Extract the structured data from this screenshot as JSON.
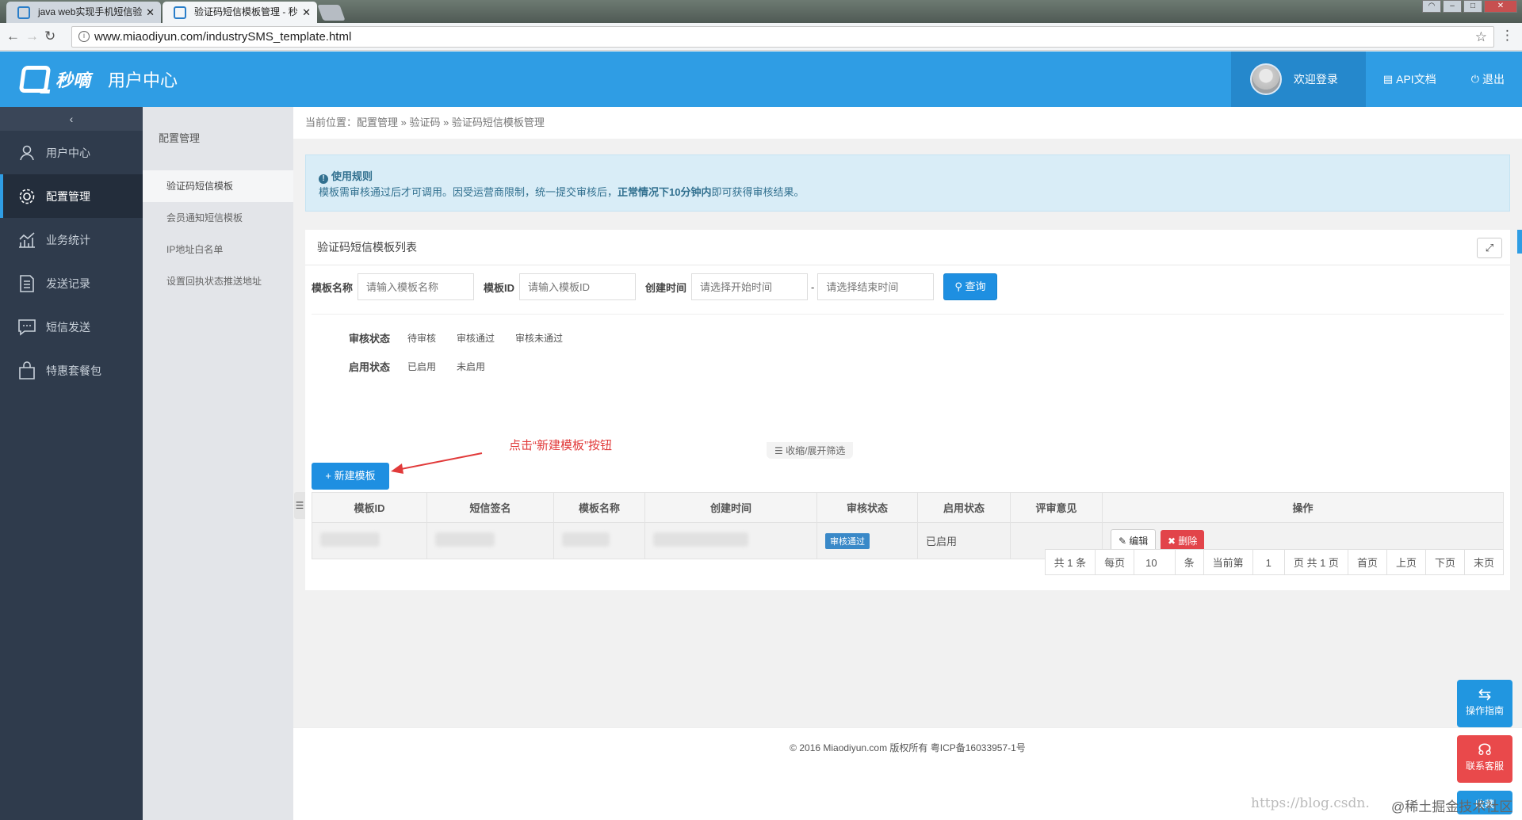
{
  "browser": {
    "tabs": [
      {
        "title": "java web实现手机短信验"
      },
      {
        "title": "验证码短信模板管理 - 秒"
      }
    ],
    "url": "www.miaodiyun.com/industrySMS_template.html"
  },
  "header": {
    "brand": "秒嘀",
    "center_title": "用户中心",
    "welcome": "欢迎登录",
    "api_doc": "API文档",
    "logout": "退出"
  },
  "sidebar": {
    "items": [
      {
        "label": "用户中心",
        "icon": "user-icon"
      },
      {
        "label": "配置管理",
        "icon": "gear-icon"
      },
      {
        "label": "业务统计",
        "icon": "chart-icon"
      },
      {
        "label": "发送记录",
        "icon": "document-icon"
      },
      {
        "label": "短信发送",
        "icon": "message-icon"
      },
      {
        "label": "特惠套餐包",
        "icon": "bag-icon"
      }
    ]
  },
  "submenu": {
    "title": "配置管理",
    "items": [
      {
        "label": "验证码短信模板"
      },
      {
        "label": "会员通知短信模板"
      },
      {
        "label": "IP地址白名单"
      },
      {
        "label": "设置回执状态推送地址"
      }
    ]
  },
  "breadcrumb": "当前位置：配置管理 » 验证码 » 验证码短信模板管理",
  "notice": {
    "title": "使用规则",
    "text_a": "模板需审核通过后才可调用。因受运营商限制，统一提交审核后，",
    "text_bold": "正常情况下10分钟内",
    "text_b": "即可获得审核结果。"
  },
  "panel": {
    "title": "验证码短信模板列表",
    "filters": {
      "name_label": "模板名称",
      "name_placeholder": "请输入模板名称",
      "id_label": "模板ID",
      "id_placeholder": "请输入模板ID",
      "time_label": "创建时间",
      "start_placeholder": "请选择开始时间",
      "dash": "-",
      "end_placeholder": "请选择结束时间",
      "query_button": "查询"
    },
    "audit": {
      "label": "审核状态",
      "options": [
        "待审核",
        "审核通过",
        "审核未通过"
      ]
    },
    "enable": {
      "label": "启用状态",
      "options": [
        "已启用",
        "未启用"
      ]
    },
    "annotation": "点击“新建模板”按钮",
    "toggle_filter": "收缩/展开筛选",
    "new_button": "新建模板",
    "table": {
      "headers": [
        "模板ID",
        "短信签名",
        "模板名称",
        "创建时间",
        "审核状态",
        "启用状态",
        "评审意见",
        "操作"
      ],
      "row": {
        "audit_status": "审核通过",
        "enable_status": "已启用",
        "edit": "编辑",
        "delete": "删除"
      }
    },
    "pager": [
      "共 1 条",
      "每页",
      "10",
      "条",
      "当前第",
      "1",
      "页 共 1 页",
      "首页",
      "上页",
      "下页",
      "末页"
    ]
  },
  "footer": "© 2016 Miaodiyun.com 版权所有 粤ICP备16033957-1号",
  "float": {
    "guide": "操作指南",
    "service": "联系客服",
    "third": "收藏"
  },
  "watermark": "https://blog.csdn.",
  "watermark2": "@稀土掘金技术社区",
  "colors": {
    "header": "#2f9de4",
    "sidebar": "#2f3b4c",
    "primary_button": "#1e8fe1",
    "danger": "#e2444a"
  }
}
